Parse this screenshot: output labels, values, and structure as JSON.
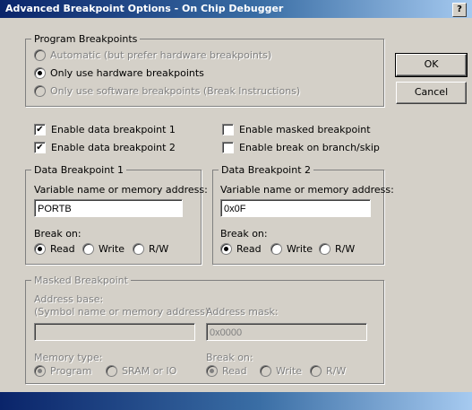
{
  "window": {
    "title": "Advanced Breakpoint Options - On Chip Debugger",
    "help_glyph": "?"
  },
  "program_breakpoints": {
    "legend": "Program Breakpoints",
    "options": [
      {
        "label": "Automatic (but prefer hardware breakpoints)",
        "selected": false,
        "enabled": false
      },
      {
        "label": "Only use hardware breakpoints",
        "selected": true,
        "enabled": true
      },
      {
        "label": "Only use software breakpoints (Break Instructions)",
        "selected": false,
        "enabled": false
      }
    ]
  },
  "buttons": {
    "ok": "OK",
    "cancel": "Cancel"
  },
  "checks": {
    "enable_bp1": {
      "label": "Enable data breakpoint 1",
      "checked": true
    },
    "enable_bp2": {
      "label": "Enable data breakpoint 2",
      "checked": true
    },
    "enable_masked": {
      "label": "Enable masked breakpoint",
      "checked": false
    },
    "enable_branch": {
      "label": "Enable break on branch/skip",
      "checked": false
    }
  },
  "data_bp1": {
    "legend": "Data Breakpoint 1",
    "addr_label": "Variable name or memory address:",
    "addr_value": "PORTB",
    "break_on_label": "Break on:",
    "options": [
      "Read",
      "Write",
      "R/W"
    ],
    "selected": "Read"
  },
  "data_bp2": {
    "legend": "Data Breakpoint 2",
    "addr_label": "Variable name or memory address:",
    "addr_value": "0x0F",
    "break_on_label": "Break on:",
    "options": [
      "Read",
      "Write",
      "R/W"
    ],
    "selected": "Read"
  },
  "masked": {
    "legend": "Masked Breakpoint",
    "addr_base_label_1": "Address base:",
    "addr_base_label_2": "(Symbol name or memory address)",
    "addr_base_value": "",
    "addr_mask_label": "Address mask:",
    "addr_mask_value": "0x0000",
    "memory_type_label": "Memory type:",
    "memory_type_options": [
      "Program",
      "SRAM or IO"
    ],
    "memory_type_selected": "Program",
    "break_on_label": "Break on:",
    "break_on_options": [
      "Read",
      "Write",
      "R/W"
    ],
    "break_on_selected": "Read"
  }
}
